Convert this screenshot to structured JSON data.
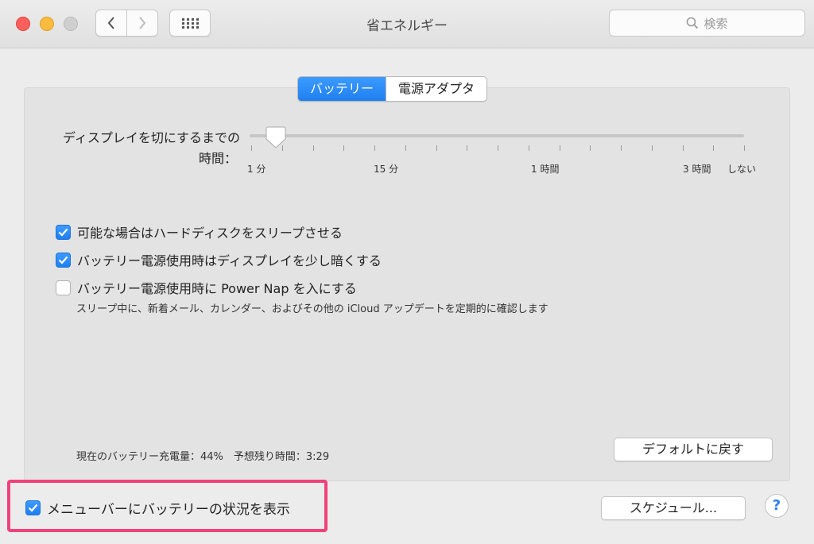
{
  "window": {
    "title": "省エネルギー",
    "search_placeholder": "検索"
  },
  "tabs": [
    {
      "label": "バッテリー",
      "active": true
    },
    {
      "label": "電源アダプタ",
      "active": false
    }
  ],
  "display_sleep": {
    "label_line1": "ディスプレイを切にするまでの",
    "label_line2": "時間：",
    "value_fraction": 0.05,
    "ticks": [
      "1 分",
      "15 分",
      "1 時間",
      "3 時間",
      "しない"
    ]
  },
  "options": [
    {
      "label": "可能な場合はハードディスクをスリープさせる",
      "checked": true
    },
    {
      "label": "バッテリー電源使用時はディスプレイを少し暗くする",
      "checked": true
    },
    {
      "label": "バッテリー電源使用時に Power Nap を入にする",
      "checked": false,
      "description": "スリープ中に、新着メール、カレンダー、およびその他の iCloud アップデートを定期的に確認します"
    }
  ],
  "status": "現在のバッテリー充電量：44%　予想残り時間：3:29",
  "buttons": {
    "restore_defaults": "デフォルトに戻す",
    "schedule": "スケジュール..."
  },
  "menu_bar_option": {
    "label": "メニューバーにバッテリーの状況を表示",
    "checked": true
  },
  "colors": {
    "accent": "#1f7ff0",
    "highlight": "#f0427a"
  }
}
